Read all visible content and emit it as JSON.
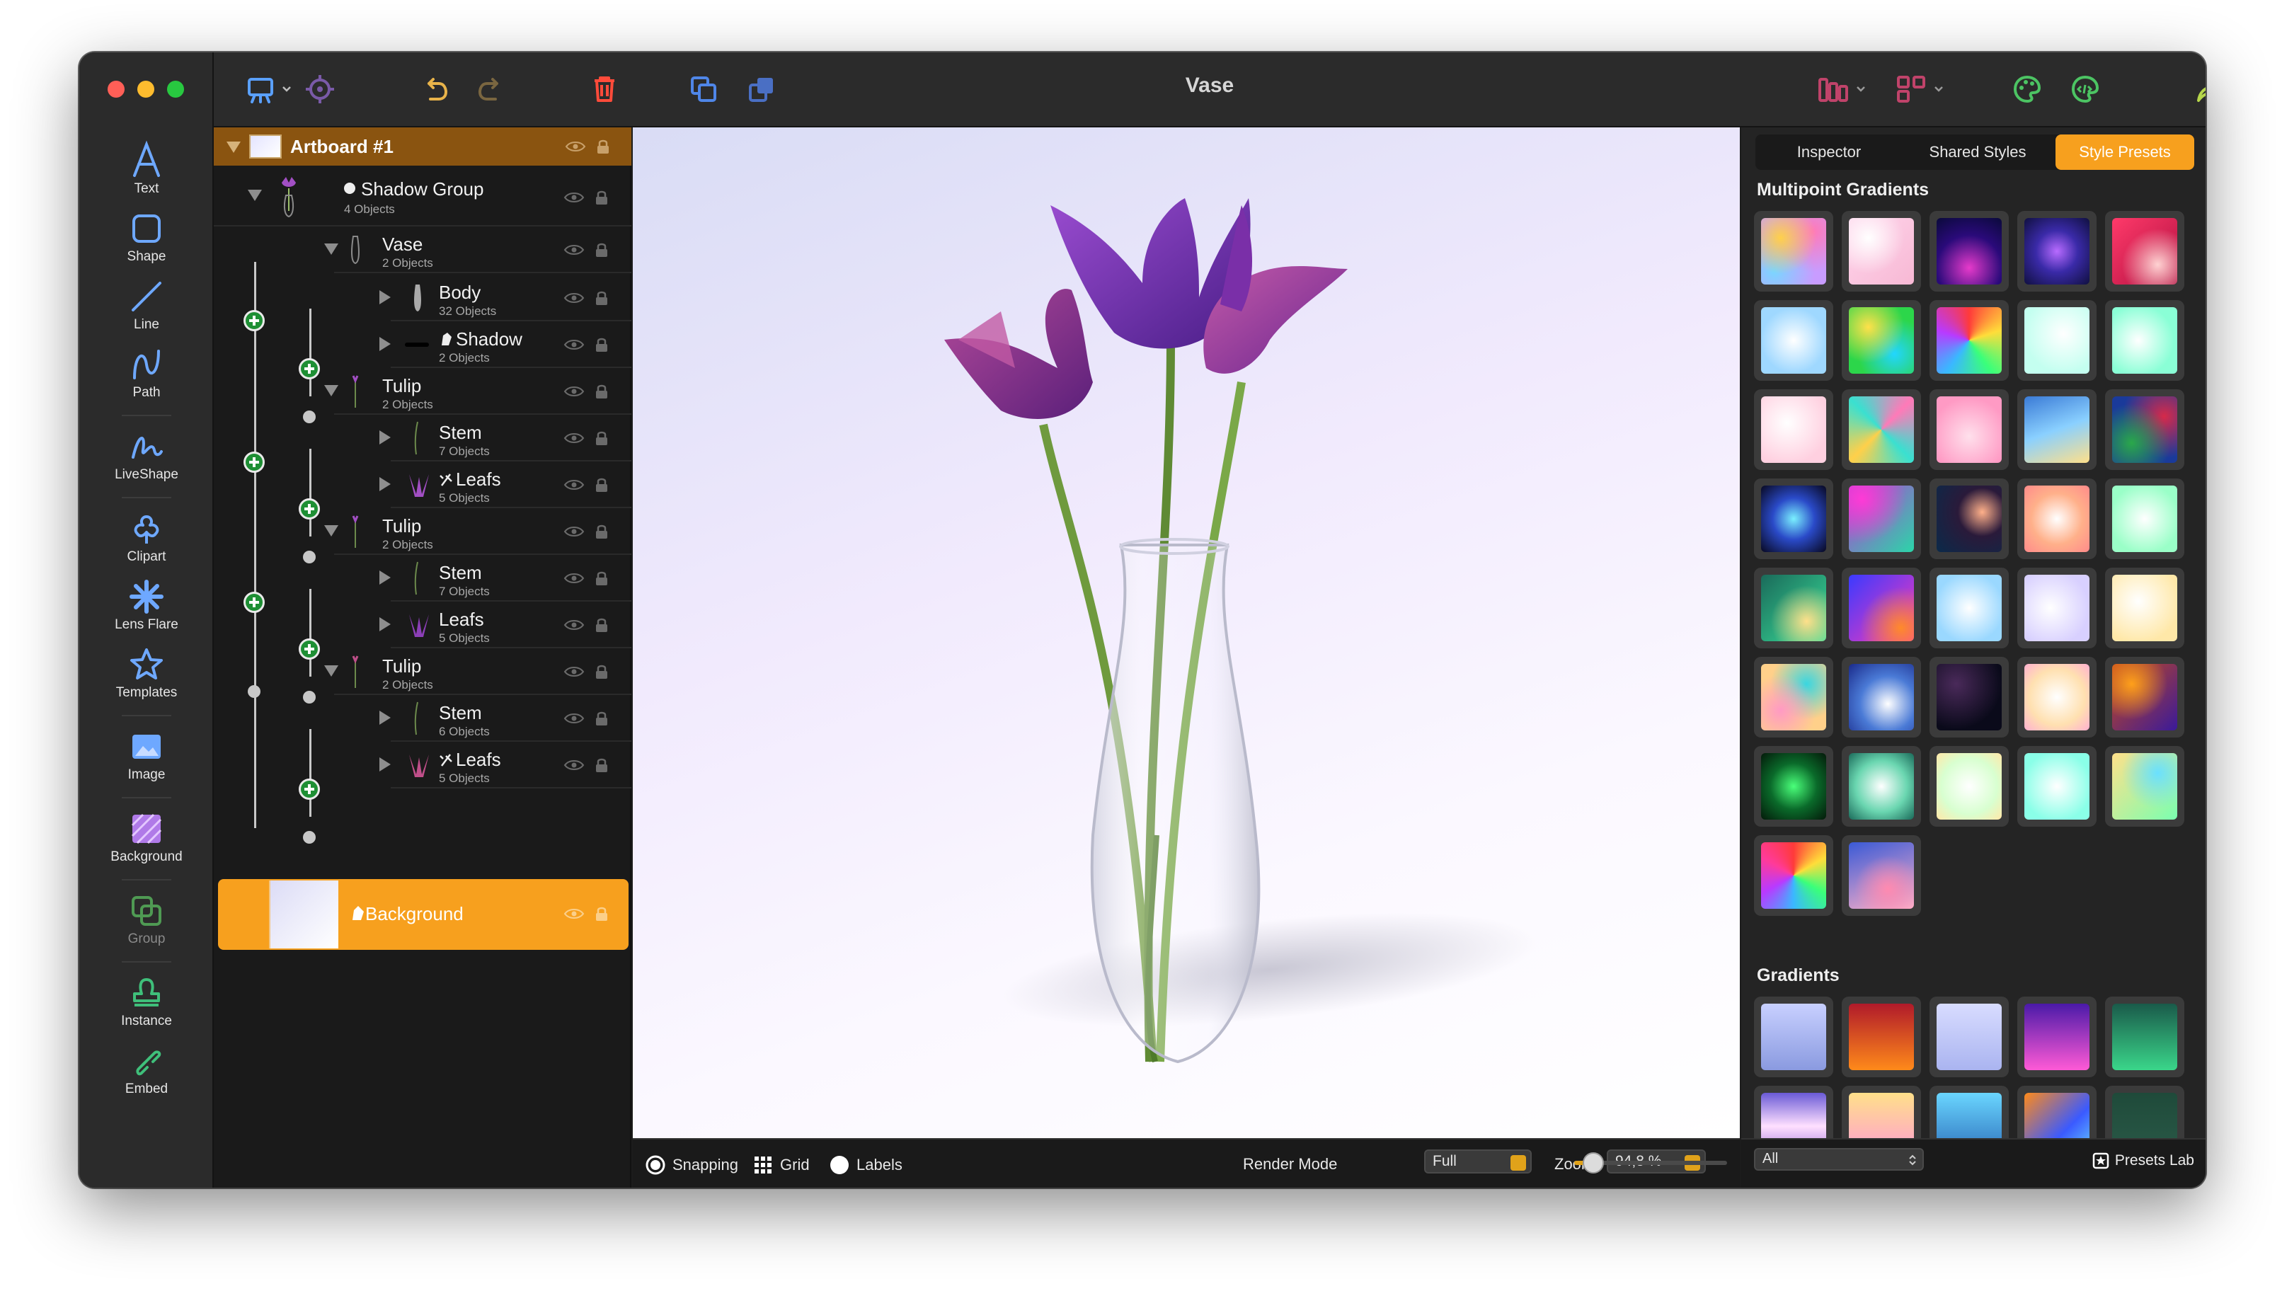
{
  "window": {
    "title": "Vase"
  },
  "tools": [
    {
      "label": "Text"
    },
    {
      "label": "Shape"
    },
    {
      "label": "Line"
    },
    {
      "label": "Path"
    },
    {
      "label": "LiveShape"
    },
    {
      "label": "Clipart"
    },
    {
      "label": "Lens Flare"
    },
    {
      "label": "Templates"
    },
    {
      "label": "Image"
    },
    {
      "label": "Background"
    },
    {
      "label": "Group"
    },
    {
      "label": "Instance"
    },
    {
      "label": "Embed"
    }
  ],
  "layers": {
    "artboard": "Artboard #1",
    "items": [
      {
        "name": "Shadow Group",
        "sub": "4 Objects"
      },
      {
        "name": "Vase",
        "sub": "2 Objects"
      },
      {
        "name": "Body",
        "sub": "32 Objects"
      },
      {
        "name": "Shadow",
        "sub": "2 Objects"
      },
      {
        "name": "Tulip",
        "sub": "2 Objects"
      },
      {
        "name": "Stem",
        "sub": "7 Objects"
      },
      {
        "name": "Leafs",
        "sub": "5 Objects"
      },
      {
        "name": "Tulip",
        "sub": "2 Objects"
      },
      {
        "name": "Stem",
        "sub": "7 Objects"
      },
      {
        "name": "Leafs",
        "sub": "5 Objects"
      },
      {
        "name": "Tulip",
        "sub": "2 Objects"
      },
      {
        "name": "Stem",
        "sub": "6 Objects"
      },
      {
        "name": "Leafs",
        "sub": "5 Objects"
      }
    ],
    "background": "Background"
  },
  "bottom_bar": {
    "snapping": "Snapping",
    "grid": "Grid",
    "labels": "Labels",
    "render_mode_label": "Render Mode",
    "render_mode_value": "Full",
    "zoom_label": "Zoom",
    "zoom_value": "94,8 %"
  },
  "right_panel": {
    "tabs": [
      {
        "label": "Inspector"
      },
      {
        "label": "Shared Styles"
      },
      {
        "label": "Style Presets"
      }
    ],
    "active_tab": "Style Presets",
    "multipoint_title": "Multipoint Gradients",
    "gradients_title": "Gradients",
    "filter_value": "All",
    "presets_lab": "Presets Lab"
  },
  "colors": {
    "accent": "#f7a01e",
    "artboard_row": "#8a5410",
    "add_green": "#1e8f34",
    "tool_icon": "#6ea8ff"
  }
}
